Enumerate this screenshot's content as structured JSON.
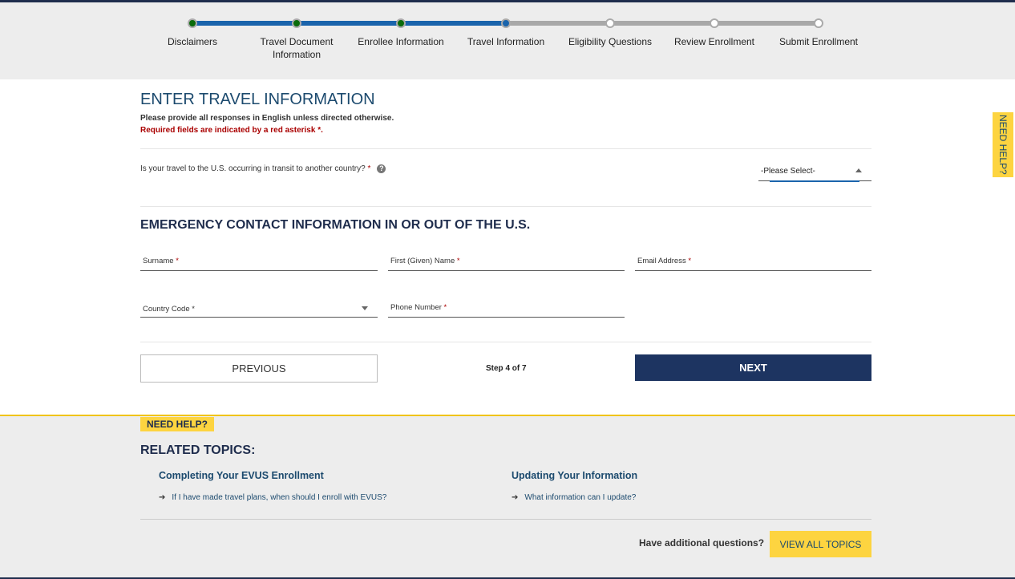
{
  "steps": [
    {
      "label": "Disclaimers",
      "state": "done"
    },
    {
      "label": "Travel Document Information",
      "state": "done"
    },
    {
      "label": "Enrollee Information",
      "state": "done"
    },
    {
      "label": "Travel Information",
      "state": "current"
    },
    {
      "label": "Eligibility Questions",
      "state": "todo"
    },
    {
      "label": "Review Enrollment",
      "state": "todo"
    },
    {
      "label": "Submit Enrollment",
      "state": "todo"
    }
  ],
  "form": {
    "title": "ENTER TRAVEL INFORMATION",
    "note1": "Please provide all responses in English unless directed otherwise.",
    "note2": "Required fields are indicated by a red asterisk ",
    "asterisk": "*",
    "note2_end": ".",
    "transit_question": "Is your travel to the U.S. occurring in transit to another country?",
    "help_icon": "?",
    "transit_select": "-Please Select-",
    "emergency_title": "EMERGENCY CONTACT INFORMATION IN OR OUT OF THE U.S.",
    "surname": "Surname",
    "first_name": "First (Given) Name",
    "email": "Email Address",
    "country_code": "Country Code",
    "phone": "Phone Number"
  },
  "nav": {
    "previous": "PREVIOUS",
    "step": "Step 4 of 7",
    "next": "NEXT"
  },
  "side_help": "NEED HELP?",
  "footer": {
    "tag": "NEED HELP?",
    "related": "RELATED TOPICS:",
    "topics": [
      {
        "title": "Completing Your EVUS Enrollment",
        "link": "If I have made travel plans, when should I enroll with EVUS?"
      },
      {
        "title": "Updating Your Information",
        "link": "What information can I update?"
      }
    ],
    "additional": "Have additional questions?",
    "view_all": "VIEW ALL TOPICS"
  }
}
